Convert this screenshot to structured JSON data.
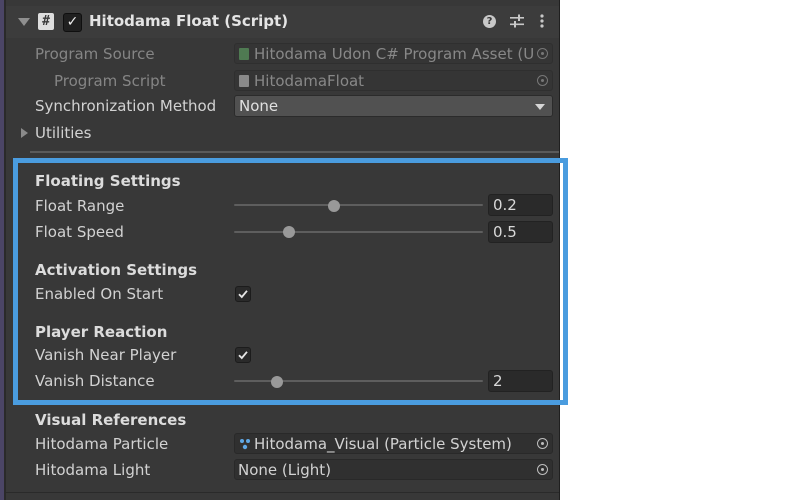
{
  "component": {
    "title": "Hitodama Float (Script)",
    "enabled": true
  },
  "fields": {
    "program_source": {
      "label": "Program Source",
      "value": "Hitodama Udon C# Program Asset (U"
    },
    "program_script": {
      "label": "Program Script",
      "value": "HitodamaFloat"
    },
    "sync_method": {
      "label": "Synchronization Method",
      "value": "None"
    },
    "utilities": {
      "label": "Utilities"
    }
  },
  "sections": {
    "floating": {
      "header": "Floating Settings",
      "float_range": {
        "label": "Float Range",
        "value": "0.2",
        "slider_fraction": 0.4
      },
      "float_speed": {
        "label": "Float Speed",
        "value": "0.5",
        "slider_fraction": 0.222
      }
    },
    "activation": {
      "header": "Activation Settings",
      "enabled_on_start": {
        "label": "Enabled On Start",
        "checked": true
      }
    },
    "player_reaction": {
      "header": "Player Reaction",
      "vanish_near_player": {
        "label": "Vanish Near Player",
        "checked": true
      },
      "vanish_distance": {
        "label": "Vanish Distance",
        "value": "2",
        "slider_fraction": 0.173
      }
    },
    "visual_references": {
      "header": "Visual References",
      "particle": {
        "label": "Hitodama Particle",
        "value": "Hitodama_Visual (Particle System)"
      },
      "light": {
        "label": "Hitodama Light",
        "value": "None (Light)"
      }
    }
  },
  "colors": {
    "panel_bg": "#383838",
    "highlight": "#4a9cdf",
    "text": "#d2d2d2",
    "disabled_text": "#858585"
  },
  "icons": {
    "component": "script-hash-icon",
    "help": "help-icon",
    "presets": "presets-sliders-icon",
    "menu": "kebab-menu-icon",
    "particle": "particle-system-icon",
    "picker": "object-picker-icon"
  }
}
